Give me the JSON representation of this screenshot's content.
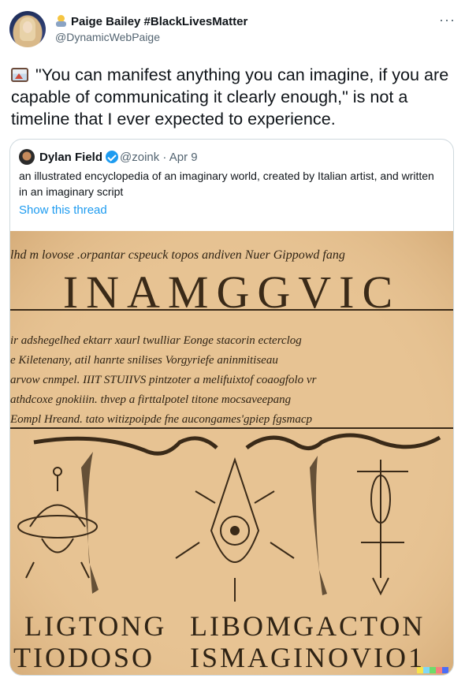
{
  "author": {
    "name": "Paige Bailey #BlackLivesMatter",
    "handle": "@DynamicWebPaige"
  },
  "tweet": {
    "text": "\"You can manifest anything you can imagine, if you are capable of communicating it clearly enough,\" is not a timeline that I ever expected to experience."
  },
  "quote": {
    "name": "Dylan Field",
    "handle": "@zoink",
    "date": "Apr 9",
    "separator": "·",
    "text": "an illustrated encyclopedia of an imaginary world, created by Italian artist, and written in an imaginary script",
    "show_thread": "Show this thread"
  },
  "image": {
    "header_line": "lhd m lovose .orpantar cspeuck topos andiven Nuer Gippowd fang",
    "title": "INAMGGVIC",
    "lines": [
      "ir adshegelhed ektarr xaurl twulliar Eonge stacorin ecterclog",
      "e Kiletenany, atil hanrte snilises Vorgyriefe aninmitiseau",
      "arvow cnmpel. IIIT STUIIVS pintzoter a melifuixtof coaogfolo vr",
      "athdcoxe gnokiiin. thvep a firttalpotel titone mocsaveepang",
      "Eompl Hreand. tato witizpoipde fne aucongames'gpiep fgsmacp"
    ],
    "caption_left_1": "LIGTONG",
    "caption_left_2": "TIODOSO",
    "caption_right_1": "LIBOMGACTON",
    "caption_right_2": "ISMAGINOVIO1"
  },
  "icons": {
    "more": "more-dots-icon",
    "verified": "verified-badge-icon",
    "picture": "framed-picture-emoji-icon"
  },
  "colors": {
    "link": "#1d9bf0",
    "muted": "#536471",
    "parchment": "#e7c393"
  }
}
